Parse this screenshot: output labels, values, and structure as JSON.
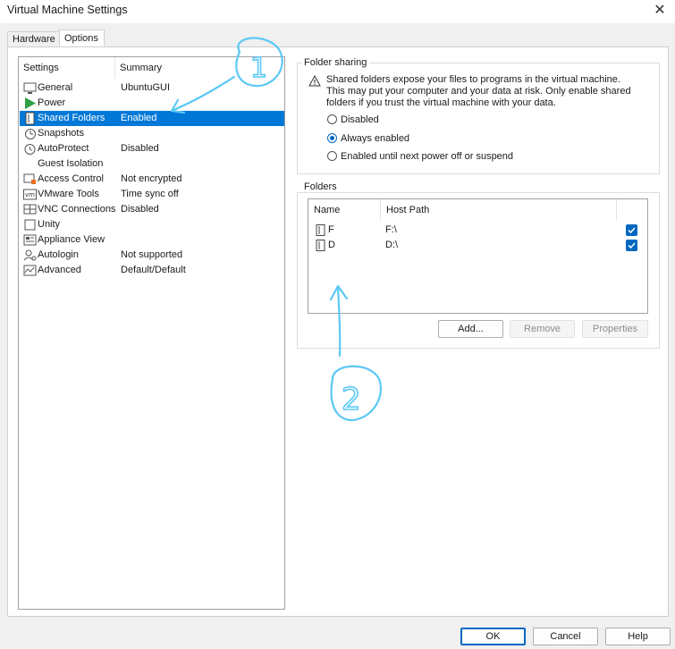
{
  "window": {
    "title": "Virtual Machine Settings",
    "close_glyph": "✕"
  },
  "tabs": [
    {
      "label": "Hardware"
    },
    {
      "label": "Options"
    }
  ],
  "settings_list": {
    "headers": {
      "settings": "Settings",
      "summary": "Summary"
    },
    "items": [
      {
        "label": "General",
        "summary": "UbuntuGUI",
        "icon": "general-icon"
      },
      {
        "label": "Power",
        "summary": "",
        "icon": "power-icon"
      },
      {
        "label": "Shared Folders",
        "summary": "Enabled",
        "icon": "shared-folders-icon",
        "selected": true
      },
      {
        "label": "Snapshots",
        "summary": "",
        "icon": "snapshots-icon"
      },
      {
        "label": "AutoProtect",
        "summary": "Disabled",
        "icon": "autoprotect-icon"
      },
      {
        "label": "Guest Isolation",
        "summary": "",
        "icon": "guest-isolation-icon"
      },
      {
        "label": "Access Control",
        "summary": "Not encrypted",
        "icon": "access-control-icon"
      },
      {
        "label": "VMware Tools",
        "summary": "Time sync off",
        "icon": "vmware-tools-icon"
      },
      {
        "label": "VNC Connections",
        "summary": "Disabled",
        "icon": "vnc-icon"
      },
      {
        "label": "Unity",
        "summary": "",
        "icon": "unity-icon"
      },
      {
        "label": "Appliance View",
        "summary": "",
        "icon": "appliance-view-icon"
      },
      {
        "label": "Autologin",
        "summary": "Not supported",
        "icon": "autologin-icon"
      },
      {
        "label": "Advanced",
        "summary": "Default/Default",
        "icon": "advanced-icon"
      }
    ]
  },
  "folder_sharing": {
    "title": "Folder sharing",
    "warning": "Shared folders expose your files to programs in the virtual machine. This may put your computer and your data at risk. Only enable shared folders if you trust the virtual machine with your data.",
    "options": [
      {
        "label": "Disabled",
        "selected": false
      },
      {
        "label": "Always enabled",
        "selected": true
      },
      {
        "label": "Enabled until next power off or suspend",
        "selected": false
      }
    ]
  },
  "folders": {
    "title": "Folders",
    "columns": {
      "name": "Name",
      "host_path": "Host Path"
    },
    "rows": [
      {
        "name": "F",
        "host_path": "F:\\",
        "enabled": true
      },
      {
        "name": "D",
        "host_path": "D:\\",
        "enabled": true
      }
    ],
    "buttons": {
      "add": "Add...",
      "remove": "Remove",
      "properties": "Properties"
    }
  },
  "dialog_buttons": {
    "ok": "OK",
    "cancel": "Cancel",
    "help": "Help"
  },
  "annotations": {
    "marker_1": "1",
    "marker_2": "2",
    "ink_color": "#5bc8f5"
  },
  "colors": {
    "selection": "#0078d7",
    "accent": "#0067c0",
    "power_green": "#2ea043"
  }
}
